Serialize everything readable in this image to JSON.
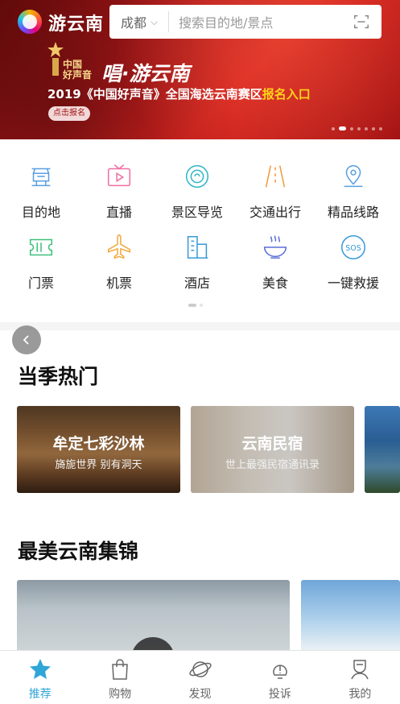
{
  "header": {
    "app_name": "游云南",
    "city": "成都",
    "search_placeholder": "搜索目的地/景点"
  },
  "banner": {
    "logo_line1": "中国",
    "logo_line2": "好声音",
    "headline": "唱·游云南",
    "subline_prefix": "2019《中国好声音》全国海选云南赛区",
    "subline_highlight": "报名入口",
    "button_label": "点击报名",
    "slide_count": 7,
    "active_slide": 1
  },
  "quick_entries": [
    {
      "label": "目的地",
      "icon": "destination-icon"
    },
    {
      "label": "直播",
      "icon": "live-icon"
    },
    {
      "label": "景区导览",
      "icon": "guide-icon"
    },
    {
      "label": "交通出行",
      "icon": "road-icon"
    },
    {
      "label": "精品线路",
      "icon": "route-pin-icon"
    },
    {
      "label": "门票",
      "icon": "ticket-icon"
    },
    {
      "label": "机票",
      "icon": "airplane-icon"
    },
    {
      "label": "酒店",
      "icon": "hotel-icon"
    },
    {
      "label": "美食",
      "icon": "food-bowl-icon"
    },
    {
      "label": "一键救援",
      "icon": "sos-icon"
    }
  ],
  "season_hot": {
    "title": "当季热门",
    "cards": [
      {
        "title": "牟定七彩沙林",
        "subtitle": "旖旎世界  别有洞天"
      },
      {
        "title": "云南民宿",
        "subtitle": "世上最强民宿通讯录"
      }
    ]
  },
  "gallery": {
    "title": "最美云南集锦"
  },
  "tabbar": {
    "items": [
      {
        "label": "推荐",
        "icon": "star-icon",
        "active": true
      },
      {
        "label": "购物",
        "icon": "shopping-bag-icon",
        "active": false
      },
      {
        "label": "发现",
        "icon": "planet-icon",
        "active": false
      },
      {
        "label": "投诉",
        "icon": "complaint-icon",
        "active": false
      },
      {
        "label": "我的",
        "icon": "profile-icon",
        "active": false
      }
    ]
  },
  "colors": {
    "accent": "#2fa6d6",
    "banner_red": "#c81d1d",
    "highlight_yellow": "#ffd31a"
  }
}
